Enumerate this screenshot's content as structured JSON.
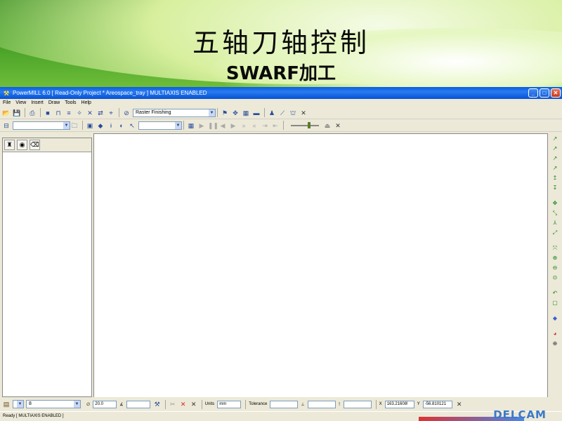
{
  "slide": {
    "title": "五轴刀轴控制",
    "subtitle": "SWARF加工"
  },
  "window": {
    "title": "PowerMILL 6.0   [ Read-Only Project * Areospace_tray ]    MULTIAXIS ENABLED",
    "minimize": "_",
    "maximize": "□",
    "close": "✕"
  },
  "menu": [
    "File",
    "View",
    "Insert",
    "Draw",
    "Tools",
    "Help"
  ],
  "toolbar1": {
    "strategy_select": "Raster Finishing"
  },
  "bottom": {
    "layer_value": "8",
    "tool_diameter": "20.0",
    "units_label": "Units",
    "units_value": "mm",
    "tolerance_label": "Tolerance",
    "x_label": "X",
    "x_value": "163.21608!",
    "y_label": "Y",
    "y_value": "-56.810121"
  },
  "status": {
    "text": "Ready  [ MULTIAXIS ENABLED ]"
  },
  "brand": {
    "logo": "DELCAM"
  },
  "colors": {
    "titlebar": "#0a5ee0",
    "chrome": "#ece9d8",
    "slide_green": "#2f8a1c"
  }
}
